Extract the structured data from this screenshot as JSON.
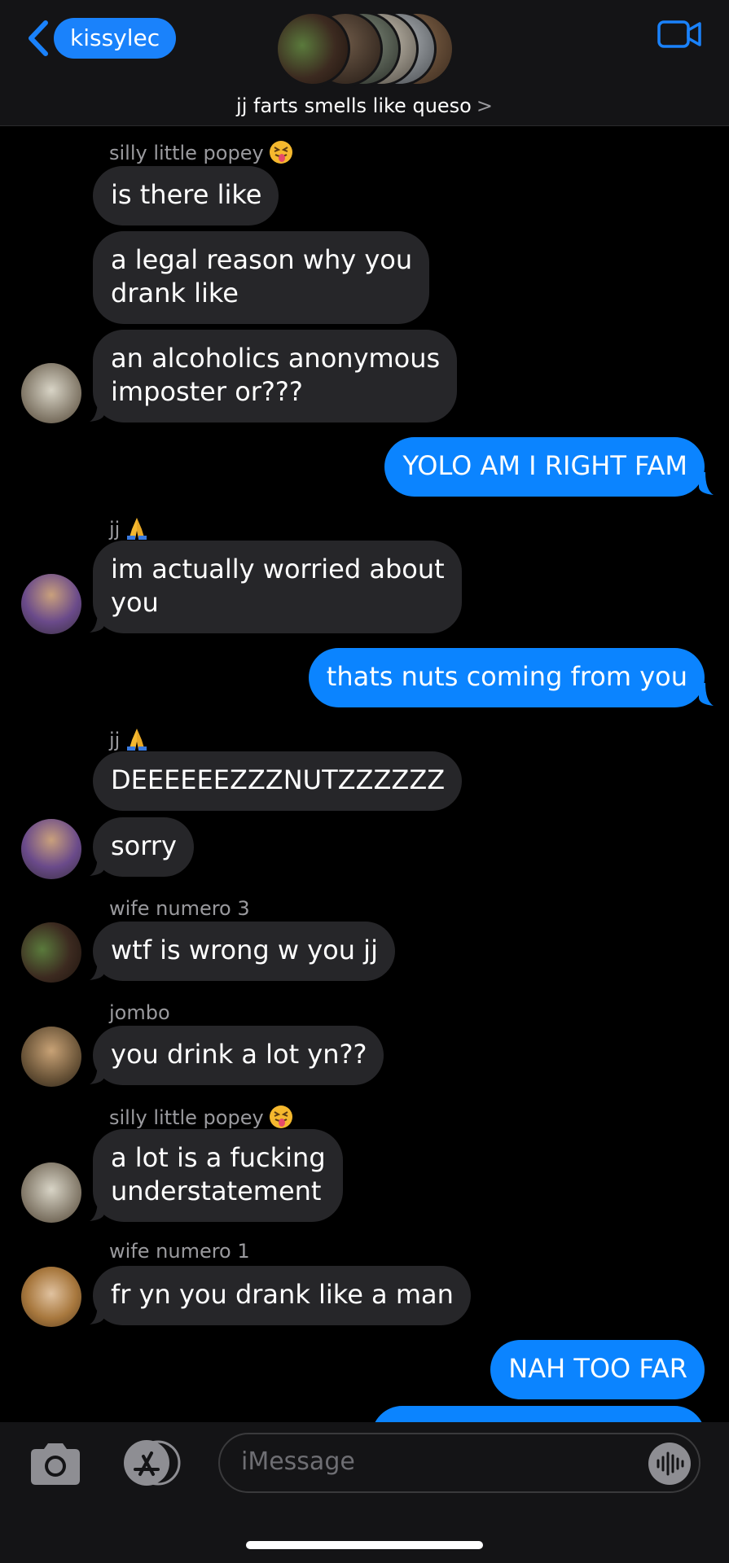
{
  "header": {
    "back_label": "kissylec",
    "group_name": "jj farts smells like queso",
    "chevron_right": ">"
  },
  "messages": [
    {
      "sender": "silly little popey",
      "text": "is there like"
    },
    {
      "text_line1": "a legal reason why you",
      "text_line2": "drank like"
    },
    {
      "text_line1": "an alcoholics anonymous",
      "text_line2": "imposter or???"
    },
    {
      "outgoing": true,
      "text": "YOLO AM I RIGHT FAM"
    },
    {
      "sender": "jj",
      "text_line1": "im actually worried about",
      "text_line2": "you"
    },
    {
      "outgoing": true,
      "text": "thats nuts coming from you"
    },
    {
      "sender": "jj",
      "text": "DEEEEEEZZZNUTZZZZZZ"
    },
    {
      "text": "sorry"
    },
    {
      "sender": "wife numero 3",
      "text": "wtf is wrong w you jj"
    },
    {
      "sender": "jombo",
      "text": "you drink a lot yn??"
    },
    {
      "sender": "silly little popey",
      "text_line1": "a lot is a fucking",
      "text_line2": "understatement"
    },
    {
      "sender": "wife numero 1",
      "text": "fr yn you drank like a man"
    },
    {
      "outgoing": true,
      "text": "NAH TOO FAR"
    }
  ],
  "input": {
    "placeholder": "iMessage"
  },
  "colors": {
    "accent_blue": "#0b84ff",
    "incoming_bubble": "#262629",
    "sender_gray": "#9a9a9e",
    "background": "#000000"
  },
  "icons": [
    "chevron-left-icon",
    "video-camera-icon",
    "camera-icon",
    "app-store-icon",
    "audio-waveform-icon",
    "squint-tongue-emoji-icon",
    "praying-hands-emoji-icon"
  ]
}
